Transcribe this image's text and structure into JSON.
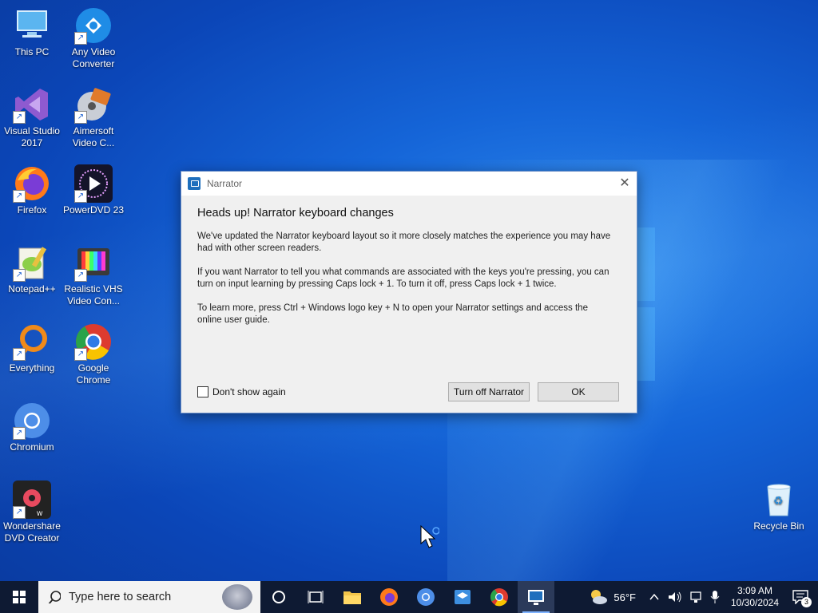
{
  "desktop_icons": [
    {
      "label": "This PC",
      "icon": "this-pc-icon",
      "color": "#4aa3e6"
    },
    {
      "label": "Any Video Converter",
      "icon": "any-video-converter-icon",
      "color": "#1f8ce6"
    },
    {
      "label": "Visual Studio 2017",
      "icon": "visual-studio-icon",
      "color": "#8e5ad0"
    },
    {
      "label": "Aimersoft Video C...",
      "icon": "aimersoft-icon",
      "color": "#e07a2a"
    },
    {
      "label": "Firefox",
      "icon": "firefox-icon",
      "color": "#ff7a1a"
    },
    {
      "label": "PowerDVD 23",
      "icon": "powerdvd-icon",
      "color": "#1a1a2a"
    },
    {
      "label": "Notepad++",
      "icon": "notepadpp-icon",
      "color": "#8ccf4a"
    },
    {
      "label": "Realistic VHS Video Con...",
      "icon": "vhs-icon",
      "color": "#444444"
    },
    {
      "label": "Everything",
      "icon": "everything-icon",
      "color": "#f08a1a"
    },
    {
      "label": "Google Chrome",
      "icon": "chrome-icon",
      "color": "#dd3b2f"
    },
    {
      "label": "Chromium",
      "icon": "chromium-icon",
      "color": "#4d8ee8"
    },
    {
      "label": "Wondershare DVD Creator",
      "icon": "wondershare-icon",
      "color": "#2a2a2a"
    },
    {
      "label": "Recycle Bin",
      "icon": "recycle-bin-icon",
      "color": "#cfe7f6"
    }
  ],
  "dialog": {
    "title": "Narrator",
    "heading": "Heads up! Narrator keyboard changes",
    "paragraphs": [
      "We've updated the Narrator keyboard layout so it more closely matches the experience you may have had with other screen readers.",
      "If you want Narrator to tell you what commands are associated with the keys you're pressing, you can turn on input learning by pressing Caps lock + 1. To turn it off, press Caps lock + 1 twice.",
      "To learn more, press Ctrl + Windows logo key + N to open your Narrator settings and access the online user guide."
    ],
    "checkbox_label": "Don't show again",
    "turn_off_label": "Turn off Narrator",
    "ok_label": "OK",
    "close_glyph": "✕"
  },
  "taskbar": {
    "search_placeholder": "Type here to search",
    "weather": "56°F",
    "time": "3:09 AM",
    "date": "10/30/2024",
    "notification_count": "3"
  }
}
